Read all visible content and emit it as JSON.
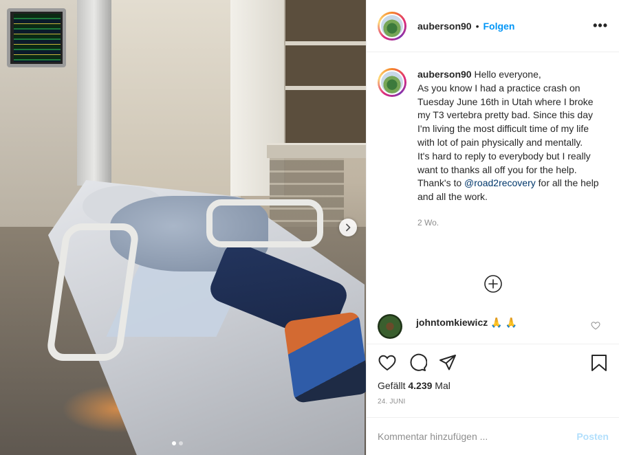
{
  "post": {
    "username": "auberson90",
    "bullet": "•",
    "follow_label": "Folgen",
    "more_label": "•••"
  },
  "caption": {
    "username": "auberson90",
    "text_1": "Hello everyone,",
    "text_2": "As you know I had a practice crash on Tuesday June 16th in Utah where I broke my T3 vertebra pretty bad. Since this day I'm living the most difficult time of my life with lot of pain physically and mentally.",
    "text_3": "It's hard to reply to everybody but I really want to thanks all off you for the help.",
    "text_4a": "Thank's to ",
    "mention": "@road2recovery",
    "text_4b": " for all the help and all the work.",
    "time": "2 Wo."
  },
  "comment": {
    "username": "johntomkiewicz",
    "emoji": "🙏 🙏"
  },
  "likes": {
    "prefix": "Gefällt ",
    "count": "4.239",
    "suffix": " Mal"
  },
  "date": "24. JUNI",
  "add_comment": {
    "placeholder": "Kommentar hinzufügen ...",
    "post_label": "Posten"
  },
  "carousel": {
    "total": 2,
    "active_index": 0
  },
  "icons": {
    "like": "heart-icon",
    "comment": "comment-icon",
    "share": "paper-plane-icon",
    "save": "bookmark-icon",
    "load_more": "plus-circle-icon",
    "next": "chevron-right-icon"
  }
}
